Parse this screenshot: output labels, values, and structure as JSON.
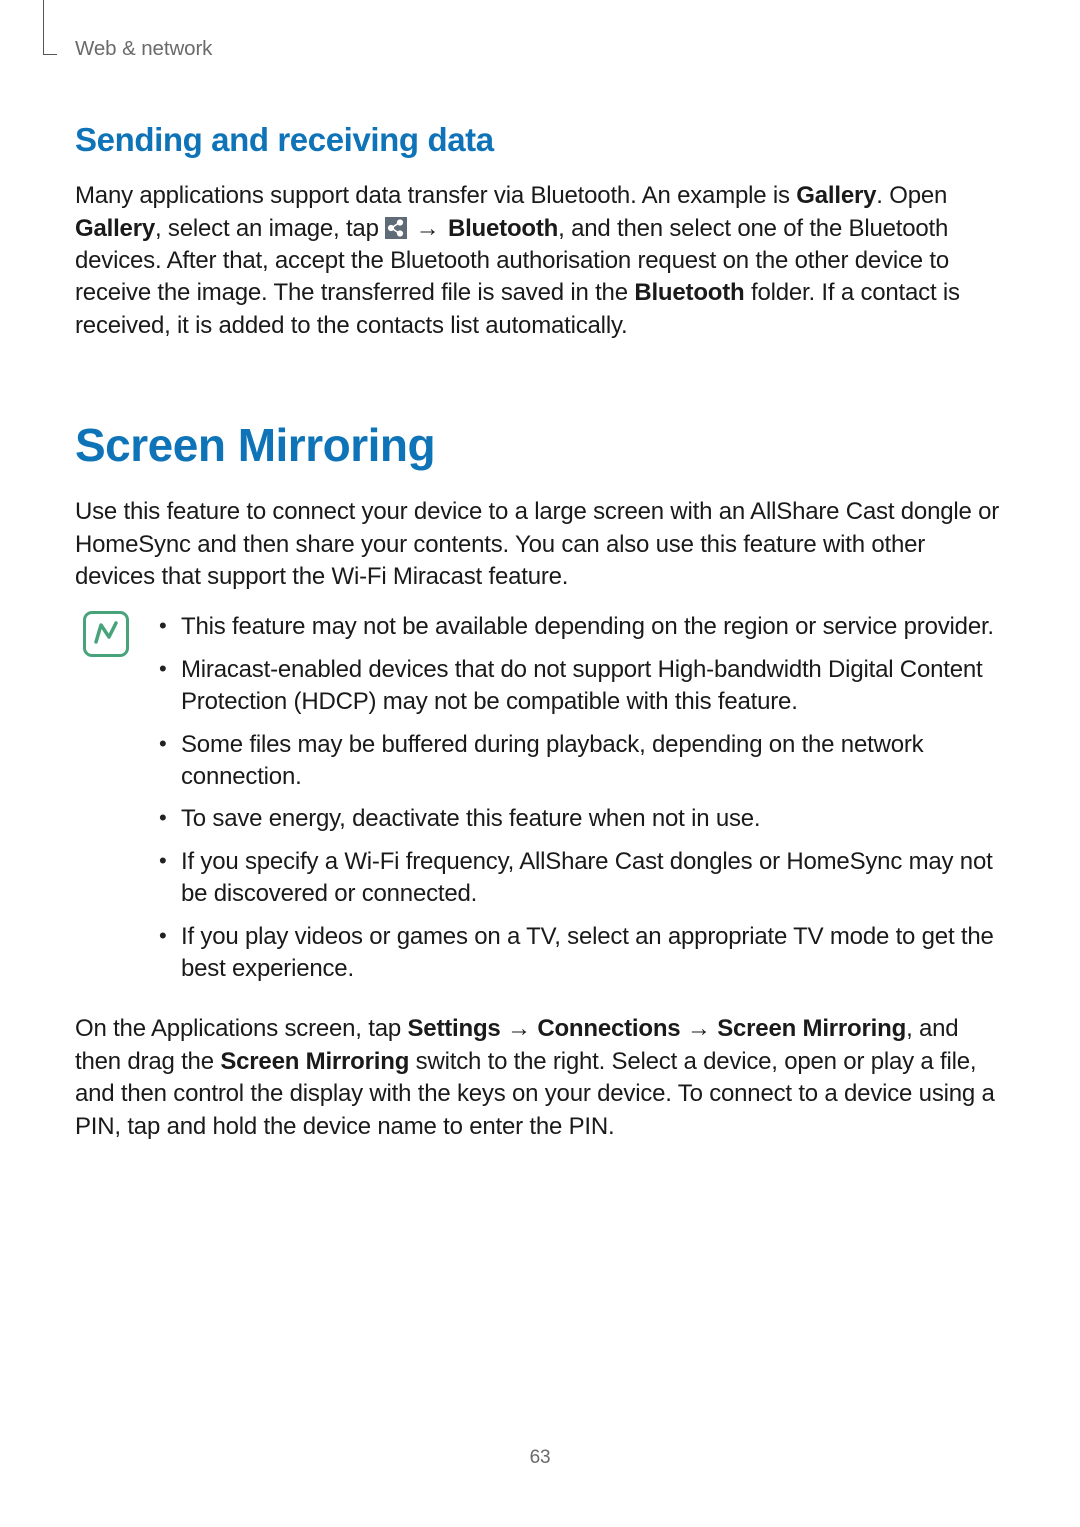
{
  "runningHead": "Web & network",
  "section1": {
    "heading": "Sending and receiving data",
    "p": {
      "t1": "Many applications support data transfer via Bluetooth. An example is ",
      "b1": "Gallery",
      "t2": ". Open ",
      "b2": "Gallery",
      "t3": ", select an image, tap ",
      "arrow": " → ",
      "b3": "Bluetooth",
      "t4": ", and then select one of the Bluetooth devices. After that, accept the Bluetooth authorisation request on the other device to receive the image. The transferred file is saved in the ",
      "b4": "Bluetooth",
      "t5": " folder. If a contact is received, it is added to the contacts list automatically."
    }
  },
  "section2": {
    "heading": "Screen Mirroring",
    "intro": "Use this feature to connect your device to a large screen with an AllShare Cast dongle or HomeSync and then share your contents. You can also use this feature with other devices that support the Wi-Fi Miracast feature.",
    "notes": [
      "This feature may not be available depending on the region or service provider.",
      "Miracast-enabled devices that do not support High-bandwidth Digital Content Protection (HDCP) may not be compatible with this feature.",
      "Some files may be buffered during playback, depending on the network connection.",
      "To save energy, deactivate this feature when not in use.",
      "If you specify a Wi-Fi frequency, AllShare Cast dongles or HomeSync may not be discovered or connected.",
      "If you play videos or games on a TV, select an appropriate TV mode to get the best experience."
    ],
    "instr": {
      "t1": "On the Applications screen, tap ",
      "b1": "Settings",
      "a1": " → ",
      "b2": "Connections",
      "a2": " → ",
      "b3": "Screen Mirroring",
      "t2": ", and then drag the ",
      "b4": "Screen Mirroring",
      "t3": " switch to the right. Select a device, open or play a file, and then control the display with the keys on your device. To connect to a device using a PIN, tap and hold the device name to enter the PIN."
    }
  },
  "pageNumber": "63"
}
